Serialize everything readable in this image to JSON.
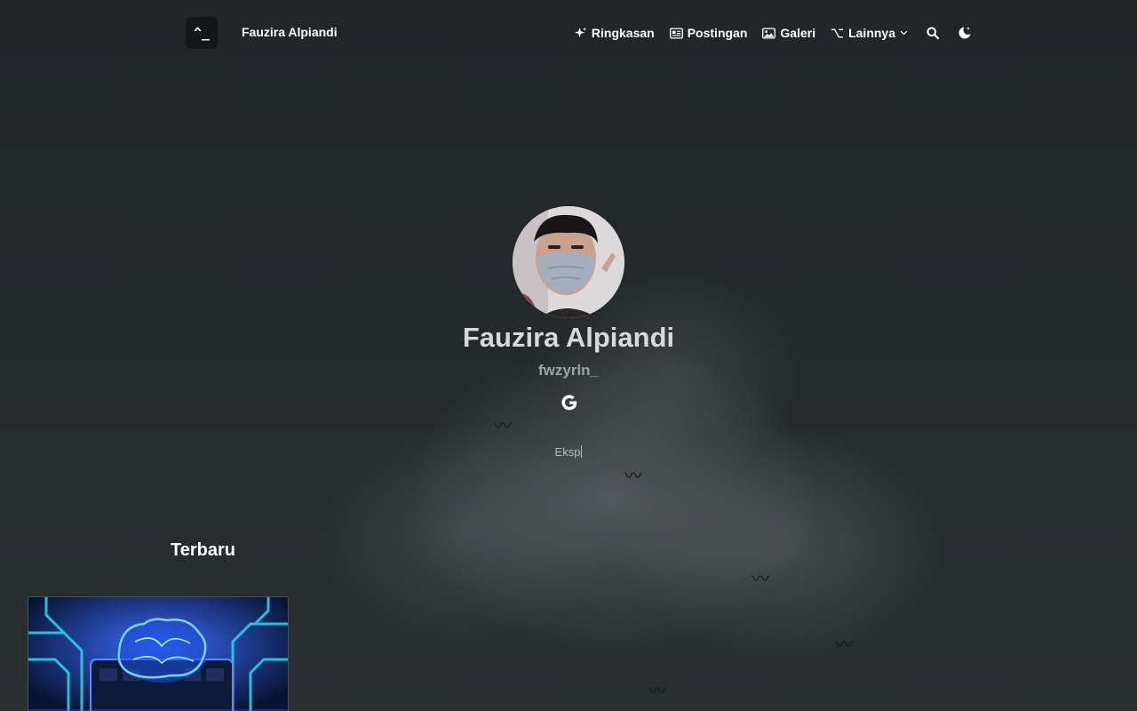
{
  "nav": {
    "logo_text": "^_",
    "site_title": "Fauzira Alpiandi",
    "items": [
      {
        "label": "Ringkasan",
        "icon": "sparkles-icon"
      },
      {
        "label": "Postingan",
        "icon": "newspaper-icon"
      },
      {
        "label": "Galeri",
        "icon": "image-icon"
      },
      {
        "label": "Lainnya",
        "icon": "option-key-icon"
      }
    ],
    "search_icon": "search-icon",
    "theme_icon": "moon-stars-icon"
  },
  "profile": {
    "name": "Fauzira Alpiandi",
    "handle": "fwzyrln_",
    "social_icon": "google-icon",
    "typing_text": "Eksp"
  },
  "latest": {
    "title": "Terbaru",
    "card_image": "ai-brain-circuit-thumbnail"
  },
  "colors": {
    "background": "#23282c",
    "text": "#ffffff",
    "muted": "#9ea3a6",
    "card_accent": "#22d3ee"
  }
}
